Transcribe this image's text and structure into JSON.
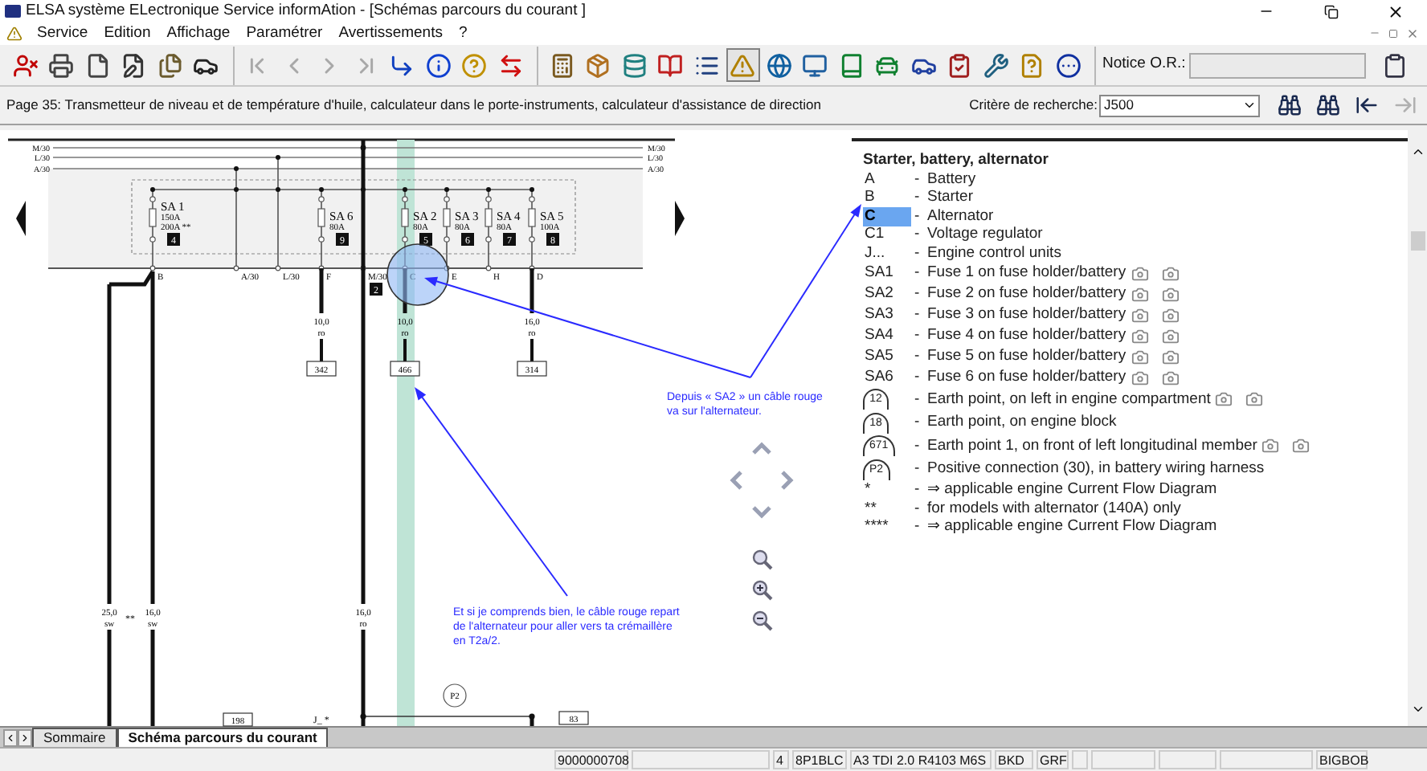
{
  "window": {
    "title": "ELSA système ELectronique Service informAtion - [Schémas parcours du courant ]"
  },
  "menu": [
    "Service",
    "Edition",
    "Affichage",
    "Paramétrer",
    "Avertissements",
    "?"
  ],
  "toolbar": {
    "groups": [
      [
        {
          "disabled": false,
          "pressed": false
        },
        {
          "disabled": false,
          "pressed": false
        },
        {
          "disabled": false,
          "pressed": false
        },
        {
          "disabled": false,
          "pressed": false
        },
        {
          "disabled": false,
          "pressed": false
        },
        {
          "disabled": false,
          "pressed": false
        }
      ],
      [
        {
          "disabled": true,
          "pressed": false
        },
        {
          "disabled": true,
          "pressed": false
        },
        {
          "disabled": true,
          "pressed": false
        },
        {
          "disabled": true,
          "pressed": false
        },
        {
          "disabled": false,
          "pressed": false
        },
        {
          "disabled": false,
          "pressed": false
        },
        {
          "disabled": false,
          "pressed": false
        },
        {
          "disabled": false,
          "pressed": false
        }
      ],
      [
        {
          "disabled": false,
          "pressed": false
        },
        {
          "disabled": false,
          "pressed": false
        },
        {
          "disabled": false,
          "pressed": false
        },
        {
          "disabled": false,
          "pressed": false
        },
        {
          "disabled": false,
          "pressed": false
        },
        {
          "disabled": false,
          "pressed": true
        },
        {
          "disabled": false,
          "pressed": false
        },
        {
          "disabled": false,
          "pressed": false
        },
        {
          "disabled": false,
          "pressed": false
        },
        {
          "disabled": false,
          "pressed": false
        },
        {
          "disabled": false,
          "pressed": false
        },
        {
          "disabled": false,
          "pressed": false
        },
        {
          "disabled": false,
          "pressed": false
        },
        {
          "disabled": false,
          "pressed": false
        },
        {
          "disabled": false,
          "pressed": false
        }
      ]
    ],
    "notice_label": "Notice O.R.:"
  },
  "info_bar": {
    "page_title": "Page 35: Transmetteur de niveau et de température d'huile, calculateur dans le porte-instruments, calculateur d'assistance de direction",
    "search_label": "Critère de recherche:",
    "search_value": "J500",
    "buttons": [
      {
        "disabled": false
      },
      {
        "disabled": false
      },
      {
        "disabled": false
      },
      {
        "disabled": true
      }
    ]
  },
  "diagram": {
    "bus_lines": [
      {
        "left": "M/30",
        "right": "M/30"
      },
      {
        "left": "L/30",
        "right": "L/30"
      },
      {
        "left": "A/30",
        "right": "A/30"
      }
    ],
    "fuses": [
      {
        "name": "SA 1",
        "ratings": [
          "150A",
          "200A **"
        ],
        "number": "4"
      },
      {
        "name": "SA 6",
        "ratings": [
          "80A"
        ],
        "number": "9"
      },
      {
        "name": "SA 2",
        "ratings": [
          "80A"
        ],
        "number": "5"
      },
      {
        "name": "SA 3",
        "ratings": [
          "80A"
        ],
        "number": "6"
      },
      {
        "name": "SA 4",
        "ratings": [
          "80A"
        ],
        "number": "7"
      },
      {
        "name": "SA 5",
        "ratings": [
          "100A"
        ],
        "number": "8"
      }
    ],
    "terminals": [
      "B",
      "A/30",
      "L/30",
      "F",
      "M/30",
      "C",
      "E",
      "H",
      "D"
    ],
    "terminal_badge": "2",
    "wires": [
      {
        "size": "25,0",
        "color_code": "sw"
      },
      {
        "size": "16,0",
        "color_code": "sw"
      },
      {
        "size": "10,0",
        "color_code": "ro",
        "connector": "342"
      },
      {
        "size": "10,0",
        "color_code": "ro",
        "connector": "466"
      },
      {
        "size": "16,0",
        "color_code": "ro",
        "connector": "314"
      },
      {
        "size": "16,0",
        "color_code": "ro"
      }
    ],
    "wire_note": "**",
    "bottom_connectors": [
      "198",
      "83"
    ],
    "junction_label": "J_ *",
    "earth_point": "P2",
    "annotations": [
      {
        "lines": [
          "Depuis « SA2 » un câble rouge",
          "va sur l'alternateur."
        ]
      },
      {
        "lines": [
          "Et si je comprends bien, le câble rouge repart",
          "de l'alternateur pour aller vers ta crémaillère",
          "en T2a/2."
        ]
      }
    ]
  },
  "legend": {
    "title": "Starter, battery, alternator",
    "items": [
      {
        "kind": "text",
        "code": "A",
        "description": "Battery",
        "selected": false
      },
      {
        "kind": "text",
        "code": "B",
        "description": "Starter",
        "selected": false
      },
      {
        "kind": "text",
        "code": "C",
        "description": "Alternator",
        "selected": true
      },
      {
        "kind": "text",
        "code": "C1",
        "description": "Voltage regulator",
        "selected": false
      },
      {
        "kind": "text",
        "code": "J...",
        "description": "Engine control units",
        "selected": false
      },
      {
        "kind": "photo",
        "code": "SA1",
        "description": "Fuse 1 on fuse holder/battery",
        "selected": false
      },
      {
        "kind": "photo",
        "code": "SA2",
        "description": "Fuse 2 on fuse holder/battery",
        "selected": false
      },
      {
        "kind": "photo",
        "code": "SA3",
        "description": "Fuse 3 on fuse holder/battery",
        "selected": false
      },
      {
        "kind": "photo",
        "code": "SA4",
        "description": "Fuse 4 on fuse holder/battery",
        "selected": false
      },
      {
        "kind": "photo",
        "code": "SA5",
        "description": "Fuse 5 on fuse holder/battery",
        "selected": false
      },
      {
        "kind": "photo",
        "code": "SA6",
        "description": "Fuse 6 on fuse holder/battery",
        "selected": false
      },
      {
        "kind": "earth_photo",
        "code": "12",
        "description": "Earth point, on left in engine compartment",
        "selected": false
      },
      {
        "kind": "earth",
        "code": "18",
        "description": "Earth point, on engine block",
        "selected": false
      },
      {
        "kind": "earth_photo",
        "code": "671",
        "description": "Earth point 1, on front of left longitudinal member",
        "selected": false
      },
      {
        "kind": "earth",
        "code": "P2",
        "description": "Positive connection (30), in battery wiring harness",
        "selected": false
      },
      {
        "kind": "text",
        "code": "*",
        "description": "⇒ applicable engine Current Flow Diagram",
        "selected": false
      },
      {
        "kind": "text",
        "code": "**",
        "description": "for models with alternator (140A) only",
        "selected": false
      },
      {
        "kind": "text",
        "code": "****",
        "description": "⇒ applicable engine Current Flow Diagram",
        "selected": false
      }
    ]
  },
  "legend_separator": "-",
  "tabs": [
    {
      "label": "Sommaire",
      "selected": false
    },
    {
      "label": "Schéma parcours du courant",
      "selected": true
    }
  ],
  "status_bar": [
    "9000000708",
    "4",
    "8P1BLC",
    "A3 TDI 2.0 R4103 M6S",
    "BKD",
    "GRF",
    "BIGBOB"
  ]
}
